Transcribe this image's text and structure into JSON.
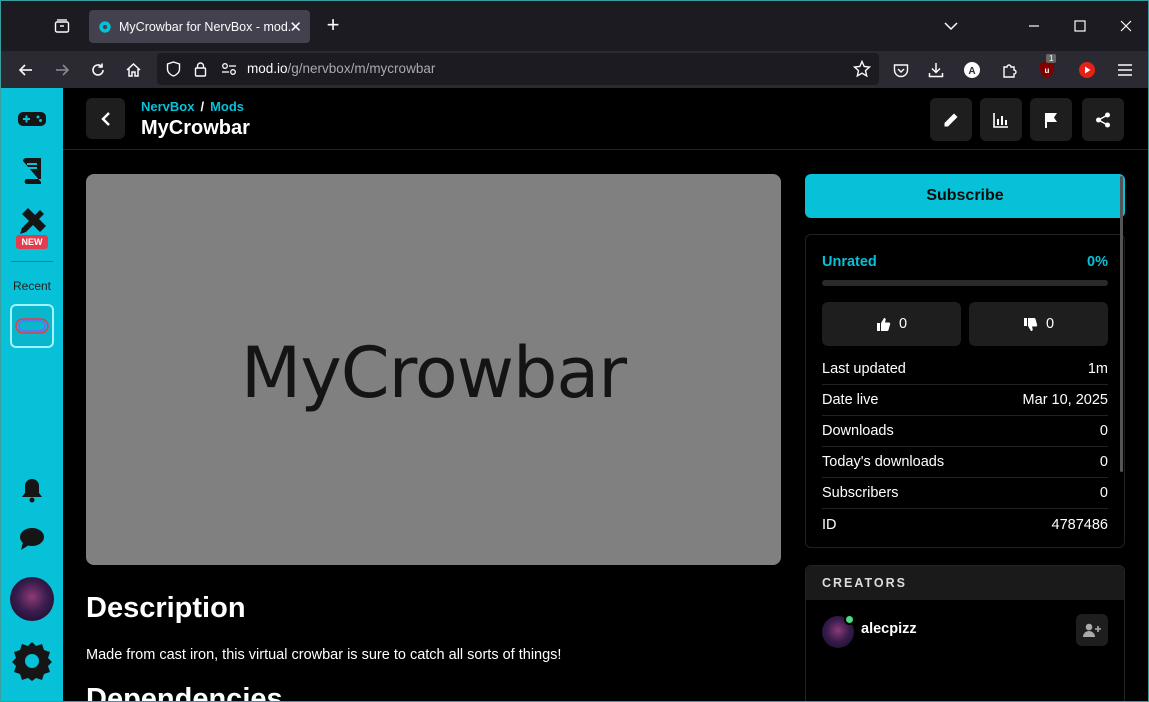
{
  "browser": {
    "tab_title": "MyCrowbar for NervBox - mod.io",
    "close_glyph": "✕",
    "new_tab_glyph": "+",
    "url_host": "mod.io",
    "url_path": "/g/nervbox/m/mycrowbar",
    "extension_badge": "1"
  },
  "header": {
    "breadcrumb_game": "NervBox",
    "breadcrumb_sep": "/",
    "breadcrumb_section": "Mods",
    "title": "MyCrowbar"
  },
  "sidebar": {
    "new_badge": "NEW",
    "recent_label": "Recent"
  },
  "main": {
    "banner_text": "MyCrowbar",
    "description_heading": "Description",
    "description_text": "Made from cast iron, this virtual crowbar is sure to catch all sorts of things!",
    "next_heading": "Dependencies"
  },
  "side_panel": {
    "subscribe_label": "Subscribe",
    "rating_label": "Unrated",
    "rating_percent": "0%",
    "rating_fill": 0,
    "thumbs_up_count": "0",
    "thumbs_down_count": "0",
    "stats": [
      {
        "label": "Last updated",
        "value": "1m"
      },
      {
        "label": "Date live",
        "value": "Mar 10, 2025"
      },
      {
        "label": "Downloads",
        "value": "0"
      },
      {
        "label": "Today's downloads",
        "value": "0"
      },
      {
        "label": "Subscribers",
        "value": "0"
      },
      {
        "label": "ID",
        "value": "4787486"
      }
    ],
    "creators_heading": "CREATORS",
    "creator_name": "alecpizz"
  },
  "colors": {
    "accent": "#07c1d8",
    "danger": "#e33c4f",
    "online": "#4ade80"
  }
}
